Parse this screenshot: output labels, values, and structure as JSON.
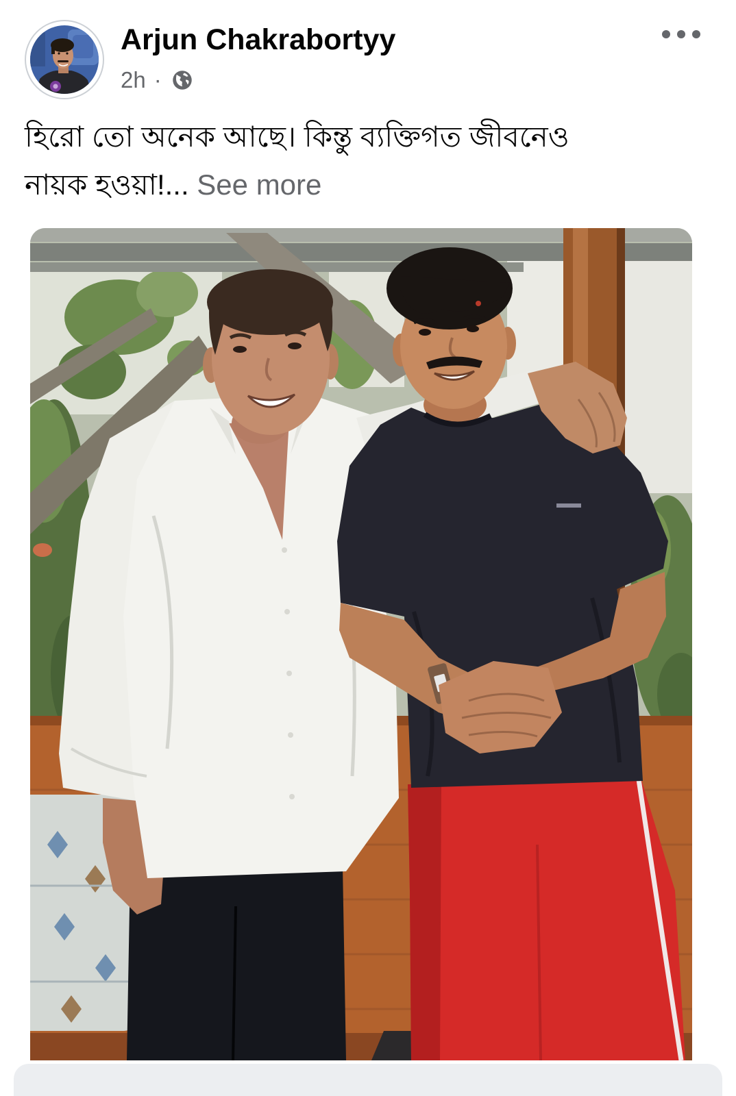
{
  "post": {
    "author": {
      "name": "Arjun Chakrabortyy",
      "avatar_icon": "profile-photo-avatar"
    },
    "meta": {
      "time": "2h",
      "separator": "·",
      "privacy_icon": "globe-icon"
    },
    "more_icon": "more-horizontal-icon",
    "text": {
      "line_1": "হিরো তো অনেক আছে। কিন্তু ব্যক্তিগত জীবনেও",
      "line_2": "নায়ক হওয়া!...",
      "see_more": "See more"
    }
  },
  "colors": {
    "background": "#ffffff",
    "primary_text": "#050505",
    "secondary_text": "#65676b",
    "avatar_ring": "#ccd0d5"
  }
}
